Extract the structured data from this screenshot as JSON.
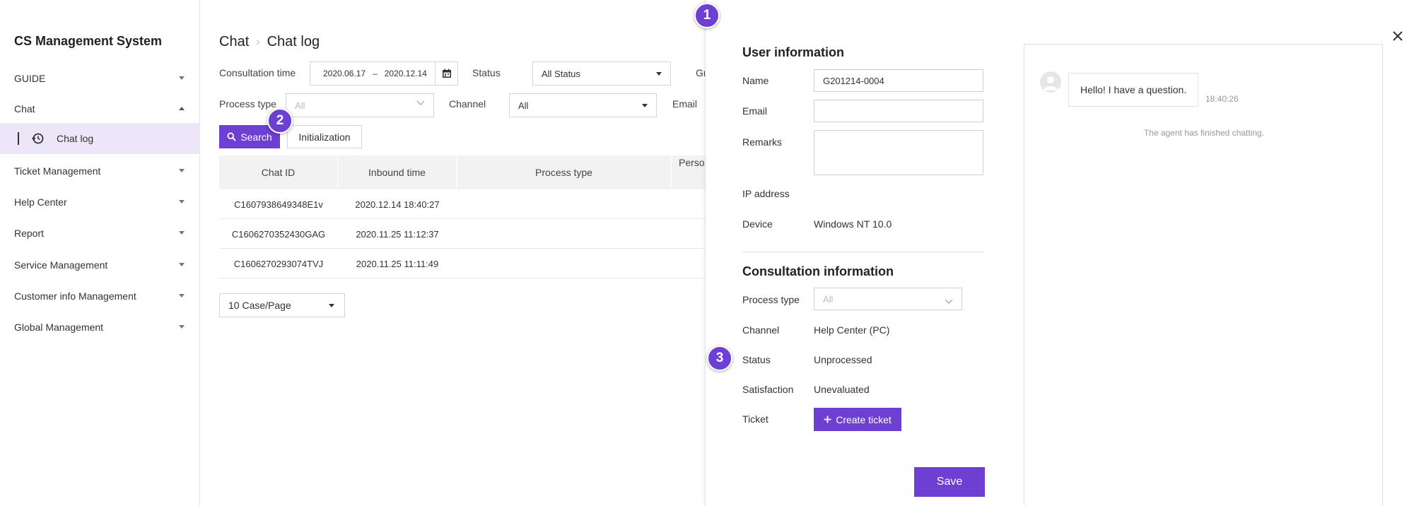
{
  "sidebar": {
    "title": "CS Management System",
    "items": [
      {
        "label": "GUIDE"
      },
      {
        "label": "Chat"
      },
      {
        "label": "Ticket Management"
      },
      {
        "label": "Help Center"
      },
      {
        "label": "Report"
      },
      {
        "label": "Service Management"
      },
      {
        "label": "Customer info Management"
      },
      {
        "label": "Global Management"
      }
    ],
    "sub_item": {
      "label": "Chat log",
      "icon": "history-icon"
    }
  },
  "breadcrumb": {
    "parent": "Chat",
    "current": "Chat log"
  },
  "filters": {
    "consultation_time_label": "Consultation time",
    "date_from": "2020.06.17",
    "date_sep": "–",
    "date_to": "2020.12.14",
    "status_label": "Status",
    "status_value": "All Status",
    "group_label_partial": "Gr",
    "process_type_label": "Process type",
    "process_type_placeholder": "All",
    "channel_label": "Channel",
    "channel_value": "All",
    "email_label": "Email",
    "search_label": "Search",
    "init_label": "Initialization"
  },
  "table": {
    "columns": [
      "Chat ID",
      "Inbound time",
      "Process type",
      "Perso"
    ],
    "rows": [
      [
        "C1607938649348E1v",
        "2020.12.14 18:40:27"
      ],
      [
        "C1606270352430GAG",
        "2020.11.25 11:12:37"
      ],
      [
        "C1606270293074TVJ",
        "2020.11.25 11:11:49"
      ]
    ]
  },
  "pager": {
    "value": "10 Case/Page"
  },
  "badges": [
    "1",
    "2",
    "3"
  ],
  "panel": {
    "user_info_title": "User information",
    "name_label": "Name",
    "name_value": "G201214-0004",
    "email_label": "Email",
    "email_value": "",
    "remarks_label": "Remarks",
    "ip_label": "IP address",
    "device_label": "Device",
    "device_value": "Windows NT 10.0",
    "consult_title": "Consultation information",
    "process_type_label": "Process type",
    "process_type_placeholder": "All",
    "channel_label": "Channel",
    "channel_value": "Help Center (PC)",
    "status_label": "Status",
    "status_value": "Unprocessed",
    "satisfaction_label": "Satisfaction",
    "satisfaction_value": "Unevaluated",
    "ticket_label": "Ticket",
    "create_ticket_label": "Create ticket",
    "save_label": "Save"
  },
  "chat": {
    "message": "Hello! I have a question.",
    "time": "18:40:26",
    "notice": "The agent has finished chatting."
  },
  "colors": {
    "accent": "#6d3fd2",
    "selected_bg": "#ece6f8"
  }
}
